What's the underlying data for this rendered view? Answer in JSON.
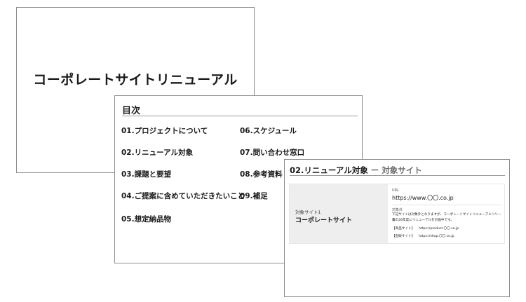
{
  "slide_title": {
    "title": "コーポレートサイトリニューアル"
  },
  "slide_toc": {
    "heading": "目次",
    "items": [
      "01.プロジェクトについて",
      "02.リニューアル対象",
      "03.課題と要望",
      "04.ご提案に含めていただきたいこと",
      "05.想定納品物",
      "06.スケジュール",
      "07.問い合わせ窓口",
      "08.参考資料",
      "09.補足"
    ]
  },
  "slide_target": {
    "heading_main": "02.リニューアル対象",
    "heading_sub": " ー 対象サイト",
    "site_label": "対象サイト1",
    "site_name": "コーポレートサイト",
    "url_label": "URL",
    "url_value": "https://www.〇〇.co.jp",
    "scope_label": "対象外",
    "scope_line1": "下記サイトは対象外となりますが、コーポレートサイトリニューアルリリース",
    "scope_line2": "後の26年度にリニューアルを計画中です。",
    "sub_sites": [
      {
        "label": "【商品サイト】",
        "url": "https://product.〇〇.co.jp"
      },
      {
        "label": "【直販サイト】",
        "url": "https://shop.〇〇.co.jp"
      }
    ]
  }
}
